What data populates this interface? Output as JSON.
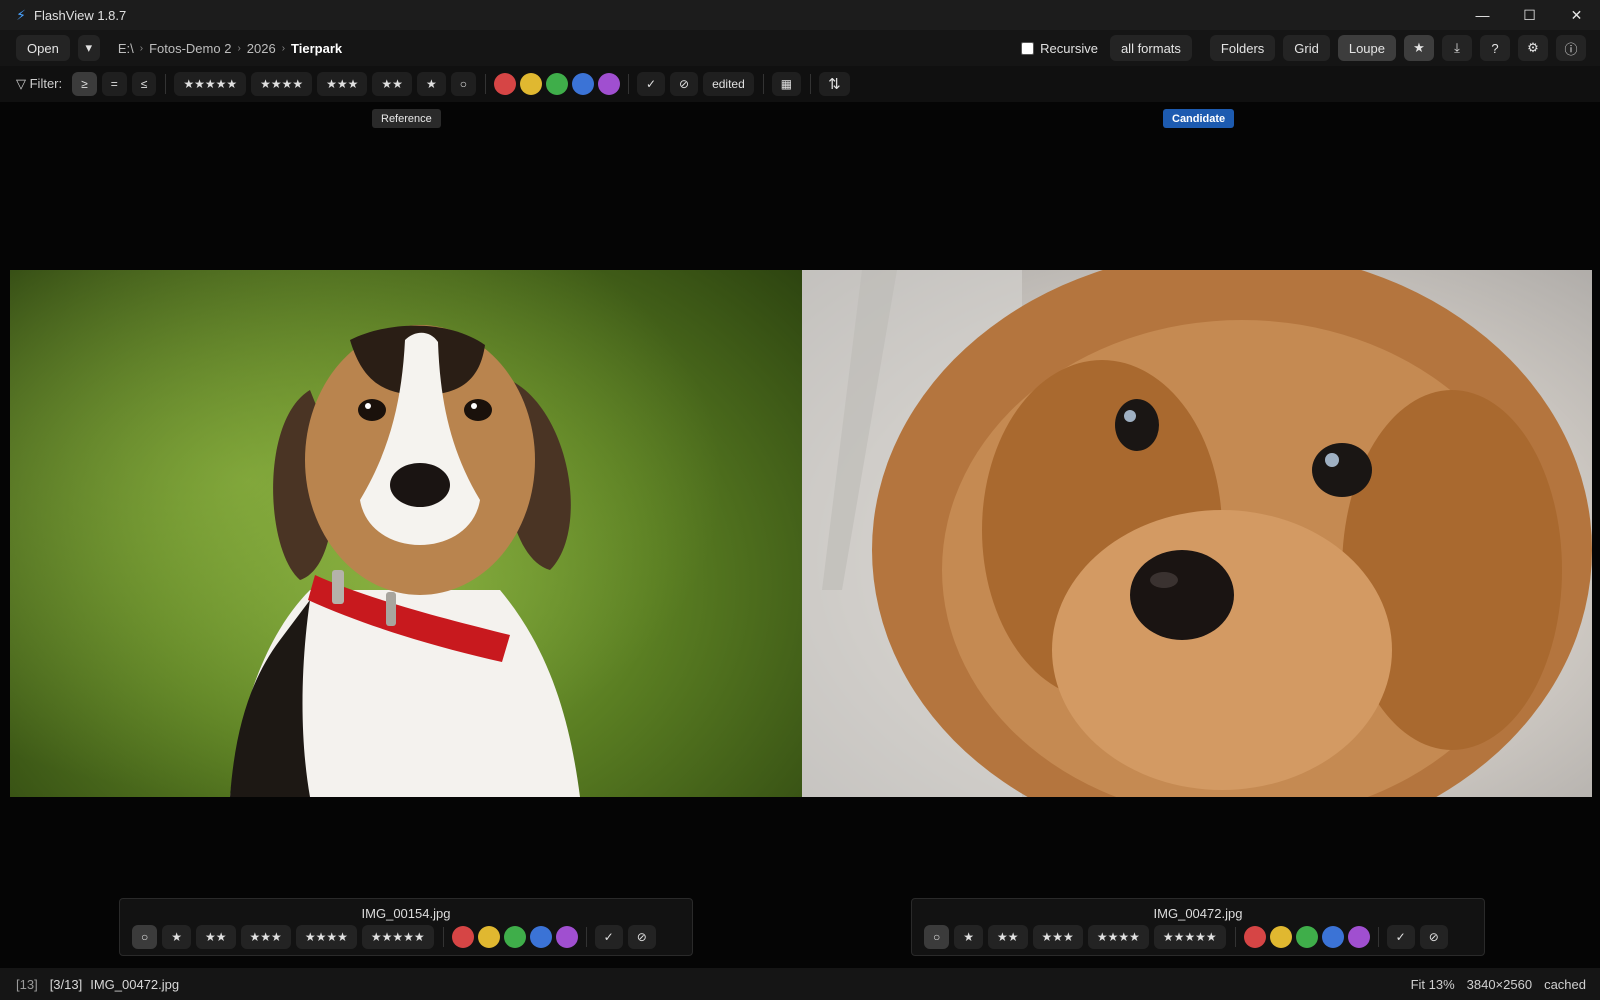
{
  "window": {
    "title": "FlashView 1.8.7",
    "logo_icon": "⚡",
    "minimize": "—",
    "maximize": "☐",
    "close": "✕"
  },
  "toolbar": {
    "open_label": "Open",
    "open_dropdown": "▾",
    "breadcrumb": [
      "E:\\",
      "Fotos-Demo 2",
      "2026",
      "Tierpark"
    ],
    "breadcrumb_sep": "›",
    "recursive_label": "Recursive",
    "recursive_checked": false,
    "formats_label": "all formats",
    "folders_label": "Folders",
    "grid_label": "Grid",
    "loupe_label": "Loupe",
    "star_icon": "★",
    "download_icon": "⤓",
    "help_icon": "?",
    "settings_icon": "⚙",
    "info_icon": "ⓘ"
  },
  "filter": {
    "label": "▽ Filter:",
    "ops": [
      "≥",
      "=",
      "≤"
    ],
    "stars": [
      "★★★★★",
      "★★★★",
      "★★★",
      "★★",
      "★",
      "○"
    ],
    "colors": [
      "#d64545",
      "#e0b830",
      "#3fae4a",
      "#3b73d6",
      "#a04fd0"
    ],
    "pick": "✓",
    "reject": "⊘",
    "edited": "edited",
    "calendar_icon": "▦",
    "sort_icon": "⇅"
  },
  "compare": {
    "reference_label": "Reference",
    "candidate_label": "Candidate",
    "left": {
      "filename": "IMG_00154.jpg",
      "ratings": [
        "○",
        "★",
        "★★",
        "★★★",
        "★★★★",
        "★★★★★"
      ],
      "pick": "✓",
      "reject": "⊘"
    },
    "right": {
      "filename": "IMG_00472.jpg",
      "ratings": [
        "○",
        "★",
        "★★",
        "★★★",
        "★★★★",
        "★★★★★"
      ],
      "pick": "✓",
      "reject": "⊘"
    }
  },
  "status": {
    "count": "[13]",
    "position": "[3/13]",
    "filename": "IMG_00472.jpg",
    "zoom": "Fit 13%",
    "dimensions": "3840×2560",
    "cache": "cached"
  }
}
